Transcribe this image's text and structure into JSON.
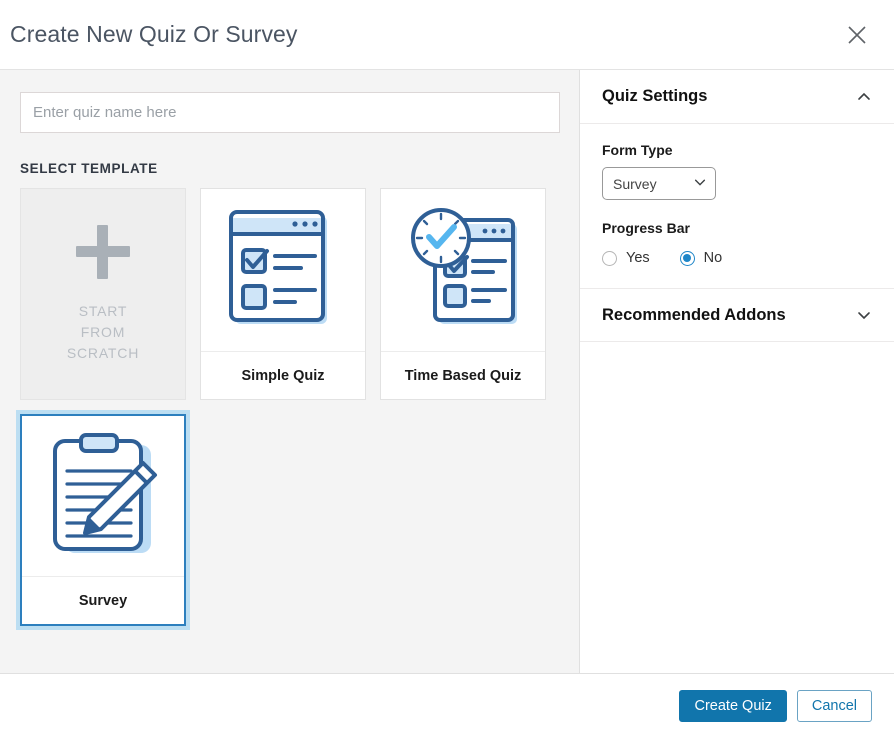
{
  "header": {
    "title": "Create New Quiz Or Survey",
    "close_icon": "close-icon"
  },
  "left": {
    "quiz_name_placeholder": "Enter quiz name here",
    "quiz_name_value": "",
    "section_label": "SELECT TEMPLATE",
    "templates": [
      {
        "id": "scratch",
        "label_lines": [
          "START",
          "FROM",
          "SCRATCH"
        ],
        "icon": "plus-icon",
        "selected": false
      },
      {
        "id": "simple-quiz",
        "label": "Simple Quiz",
        "icon": "browser-checklist-icon",
        "selected": false
      },
      {
        "id": "time-based-quiz",
        "label": "Time Based Quiz",
        "icon": "clock-browser-checklist-icon",
        "selected": false
      },
      {
        "id": "survey",
        "label": "Survey",
        "icon": "clipboard-pencil-icon",
        "selected": true
      }
    ]
  },
  "settings": {
    "quiz_settings_title": "Quiz Settings",
    "quiz_settings_chevron": "chevron-up-icon",
    "form_type_label": "Form Type",
    "form_type_value": "Survey",
    "form_type_chevron": "chevron-down-icon",
    "progress_bar_label": "Progress Bar",
    "progress_yes_label": "Yes",
    "progress_no_label": "No",
    "progress_selected": "No",
    "addons_title": "Recommended Addons",
    "addons_chevron": "chevron-down-icon"
  },
  "footer": {
    "create_label": "Create Quiz",
    "cancel_label": "Cancel"
  },
  "colors": {
    "primary_blue": "#1175ac",
    "selection_blue": "#2d7fbe",
    "radio_blue": "#1f86c8",
    "art_dark_blue": "#2f5f96",
    "art_light_blue": "#bcdcf5",
    "left_bg": "#f4f4f4"
  }
}
